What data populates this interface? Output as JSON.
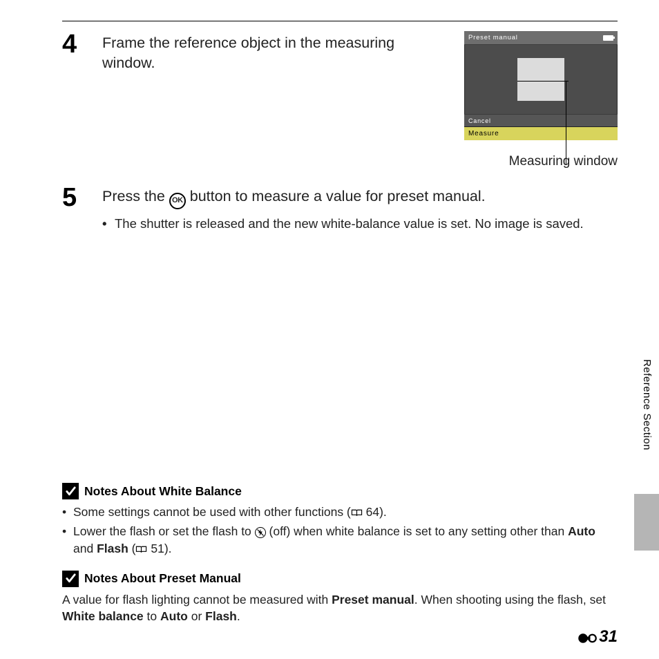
{
  "step4": {
    "number": "4",
    "text_line1": "Frame the reference object in the measuring",
    "text_line2": "window."
  },
  "lcd": {
    "title": "Preset manual",
    "cancel": "Cancel",
    "measure": "Measure",
    "caption": "Measuring window"
  },
  "step5": {
    "number": "5",
    "pre": "Press the ",
    "ok": "OK",
    "post": " button to measure a value for preset manual.",
    "bullet": "The shutter is released and the new white-balance value is set. No image is saved."
  },
  "notes_wb": {
    "title": "Notes About White Balance",
    "b1_pre": "Some settings cannot be used with other functions (",
    "b1_ref": "64",
    "b1_post": ").",
    "b2_pre": "Lower the flash or set the flash to ",
    "b2_mid": " (off) when white balance is set to any setting other than ",
    "b2_auto": "Auto",
    "b2_and": " and ",
    "b2_flash": "Flash",
    "b2_paren_pre": " (",
    "b2_ref": "51",
    "b2_paren_post": ")."
  },
  "notes_pm": {
    "title": "Notes About Preset Manual",
    "line1_pre": "A value for flash lighting cannot be measured with ",
    "line1_bold": "Preset manual",
    "line1_post": ". When shooting using the flash, set ",
    "line1_wb": "White balance",
    "line1_to": " to ",
    "line1_auto": "Auto",
    "line1_or": " or ",
    "line1_flash": "Flash",
    "line1_end": "."
  },
  "side": {
    "ref": "Reference Section"
  },
  "page": {
    "num": "31"
  }
}
